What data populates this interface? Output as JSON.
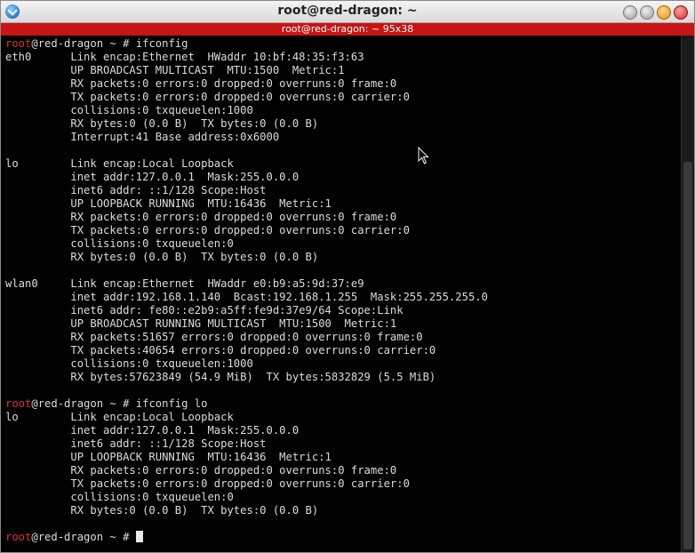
{
  "window": {
    "title": "root@red-dragon: ~",
    "tab_label": "root@red-dragon: ~ 95x38",
    "icon": "terminal-app-icon",
    "buttons": [
      "minimize-icon",
      "restore-icon",
      "shade-icon",
      "close-icon"
    ]
  },
  "prompt": {
    "user": "root",
    "rest": "@red-dragon ~ # "
  },
  "lines": [
    {
      "type": "prompt",
      "cmd": "ifconfig"
    },
    {
      "type": "out",
      "text": "eth0      Link encap:Ethernet  HWaddr 10:bf:48:35:f3:63"
    },
    {
      "type": "out",
      "text": "          UP BROADCAST MULTICAST  MTU:1500  Metric:1"
    },
    {
      "type": "out",
      "text": "          RX packets:0 errors:0 dropped:0 overruns:0 frame:0"
    },
    {
      "type": "out",
      "text": "          TX packets:0 errors:0 dropped:0 overruns:0 carrier:0"
    },
    {
      "type": "out",
      "text": "          collisions:0 txqueuelen:1000"
    },
    {
      "type": "out",
      "text": "          RX bytes:0 (0.0 B)  TX bytes:0 (0.0 B)"
    },
    {
      "type": "out",
      "text": "          Interrupt:41 Base address:0x6000"
    },
    {
      "type": "out",
      "text": ""
    },
    {
      "type": "out",
      "text": "lo        Link encap:Local Loopback"
    },
    {
      "type": "out",
      "text": "          inet addr:127.0.0.1  Mask:255.0.0.0"
    },
    {
      "type": "out",
      "text": "          inet6 addr: ::1/128 Scope:Host"
    },
    {
      "type": "out",
      "text": "          UP LOOPBACK RUNNING  MTU:16436  Metric:1"
    },
    {
      "type": "out",
      "text": "          RX packets:0 errors:0 dropped:0 overruns:0 frame:0"
    },
    {
      "type": "out",
      "text": "          TX packets:0 errors:0 dropped:0 overruns:0 carrier:0"
    },
    {
      "type": "out",
      "text": "          collisions:0 txqueuelen:0"
    },
    {
      "type": "out",
      "text": "          RX bytes:0 (0.0 B)  TX bytes:0 (0.0 B)"
    },
    {
      "type": "out",
      "text": ""
    },
    {
      "type": "out",
      "text": "wlan0     Link encap:Ethernet  HWaddr e0:b9:a5:9d:37:e9"
    },
    {
      "type": "out",
      "text": "          inet addr:192.168.1.140  Bcast:192.168.1.255  Mask:255.255.255.0"
    },
    {
      "type": "out",
      "text": "          inet6 addr: fe80::e2b9:a5ff:fe9d:37e9/64 Scope:Link"
    },
    {
      "type": "out",
      "text": "          UP BROADCAST RUNNING MULTICAST  MTU:1500  Metric:1"
    },
    {
      "type": "out",
      "text": "          RX packets:51657 errors:0 dropped:0 overruns:0 frame:0"
    },
    {
      "type": "out",
      "text": "          TX packets:40654 errors:0 dropped:0 overruns:0 carrier:0"
    },
    {
      "type": "out",
      "text": "          collisions:0 txqueuelen:1000"
    },
    {
      "type": "out",
      "text": "          RX bytes:57623849 (54.9 MiB)  TX bytes:5832829 (5.5 MiB)"
    },
    {
      "type": "out",
      "text": ""
    },
    {
      "type": "prompt",
      "cmd": "ifconfig lo"
    },
    {
      "type": "out",
      "text": "lo        Link encap:Local Loopback"
    },
    {
      "type": "out",
      "text": "          inet addr:127.0.0.1  Mask:255.0.0.0"
    },
    {
      "type": "out",
      "text": "          inet6 addr: ::1/128 Scope:Host"
    },
    {
      "type": "out",
      "text": "          UP LOOPBACK RUNNING  MTU:16436  Metric:1"
    },
    {
      "type": "out",
      "text": "          RX packets:0 errors:0 dropped:0 overruns:0 frame:0"
    },
    {
      "type": "out",
      "text": "          TX packets:0 errors:0 dropped:0 overruns:0 carrier:0"
    },
    {
      "type": "out",
      "text": "          collisions:0 txqueuelen:0"
    },
    {
      "type": "out",
      "text": "          RX bytes:0 (0.0 B)  TX bytes:0 (0.0 B)"
    },
    {
      "type": "out",
      "text": ""
    },
    {
      "type": "active-prompt",
      "cmd": ""
    }
  ],
  "colors": {
    "background": "#000000",
    "foreground": "#dcdcdc",
    "prompt_user": "#e23030",
    "tab_bar": "#c81414"
  }
}
